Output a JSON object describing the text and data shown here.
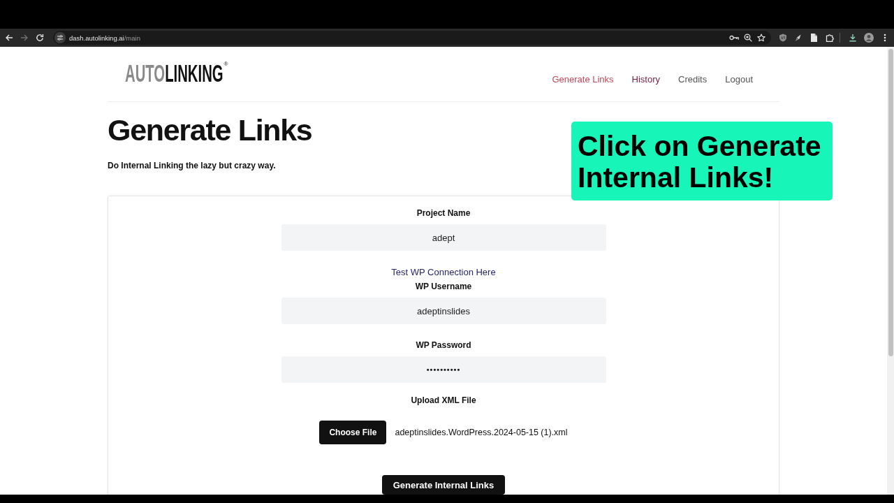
{
  "browser": {
    "url_host": "dash.autolinking.ai",
    "url_path": "/main",
    "forward_disabled": true
  },
  "header": {
    "logo": {
      "prefix": "AUTO",
      "name": "LINKING",
      "mark": "®"
    },
    "nav": [
      {
        "label": "Generate Links",
        "selected": true,
        "hovered": false
      },
      {
        "label": "History",
        "selected": false,
        "hovered": true
      },
      {
        "label": "Credits",
        "selected": false,
        "hovered": false
      },
      {
        "label": "Logout",
        "selected": false,
        "hovered": false
      }
    ]
  },
  "page": {
    "title": "Generate Links",
    "subtitle": "Do Internal Linking the lazy but crazy way."
  },
  "form": {
    "items": [
      {
        "kind": "text",
        "label": "Project Name",
        "value": "adept"
      },
      {
        "kind": "link",
        "text": "Test WP Connection Here"
      },
      {
        "kind": "text",
        "label": "WP Username",
        "value": "adeptinslides"
      },
      {
        "kind": "password",
        "label": "WP Password",
        "value": "••••••••••"
      },
      {
        "kind": "file",
        "label": "Upload XML File",
        "button": "Choose File",
        "file_name": "adeptinslides.WordPress.2024-05-15 (1).xml"
      }
    ],
    "submit": "Generate Internal Links"
  },
  "callout": {
    "text": "Click on Generate Internal Links!"
  }
}
